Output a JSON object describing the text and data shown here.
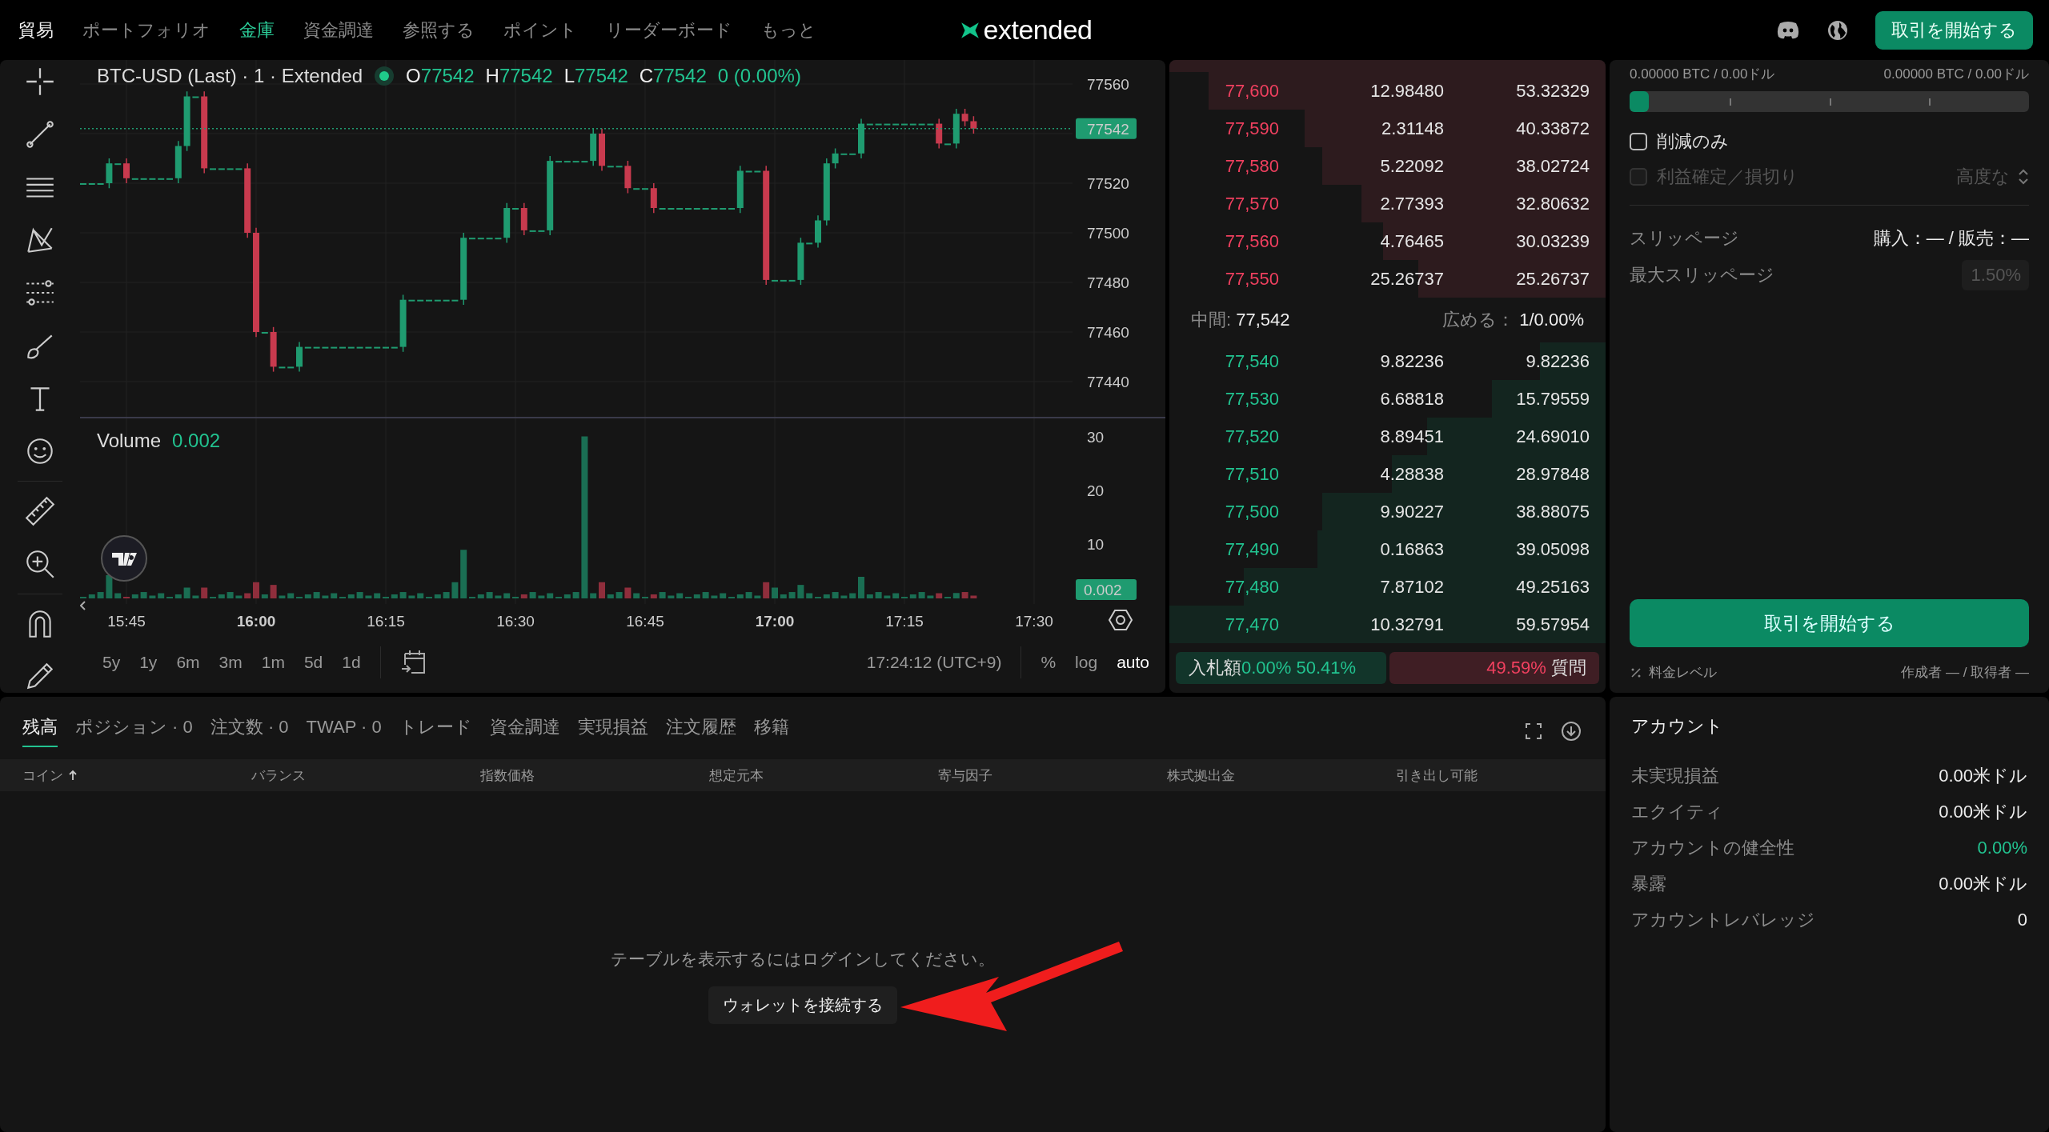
{
  "nav": {
    "items": [
      {
        "label": "貿易",
        "selected": true,
        "hovered": false
      },
      {
        "label": "ポートフォリオ",
        "selected": false,
        "hovered": false
      },
      {
        "label": "金庫",
        "selected": false,
        "hovered": true
      },
      {
        "label": "資金調達",
        "selected": false,
        "hovered": false
      },
      {
        "label": "参照する",
        "selected": false,
        "hovered": false
      },
      {
        "label": "ポイント",
        "selected": false,
        "hovered": false
      },
      {
        "label": "リーダーボード",
        "selected": false,
        "hovered": false
      },
      {
        "label": "もっと",
        "selected": false,
        "hovered": false
      }
    ],
    "logo": "extended",
    "start_button": "取引を開始する"
  },
  "chart": {
    "symbol": "BTC-USD (Last) · 1 · Extended",
    "ohlc": [
      {
        "key": "O",
        "value": "77542"
      },
      {
        "key": "H",
        "value": "77542"
      },
      {
        "key": "L",
        "value": "77542"
      },
      {
        "key": "C",
        "value": "77542"
      }
    ],
    "change": "0 (0.00%)",
    "price_labels": [
      "77560",
      "77520",
      "77500",
      "77480",
      "77460",
      "77440"
    ],
    "last_price": "77542",
    "volume_label": "Volume",
    "volume_value": "0.002",
    "volume_labels": [
      "30",
      "20",
      "10"
    ],
    "volume_badge": "0.002",
    "time_labels": [
      {
        "text": "15:45",
        "emphasized": false
      },
      {
        "text": "16:00",
        "emphasized": true
      },
      {
        "text": "16:15",
        "emphasized": false
      },
      {
        "text": "16:30",
        "emphasized": false
      },
      {
        "text": "16:45",
        "emphasized": false
      },
      {
        "text": "17:00",
        "emphasized": true
      },
      {
        "text": "17:15",
        "emphasized": false
      },
      {
        "text": "17:30",
        "emphasized": false
      }
    ],
    "ranges": [
      "5y",
      "1y",
      "6m",
      "3m",
      "1m",
      "5d",
      "1d"
    ],
    "clock": "17:24:12 (UTC+9)",
    "scale_options": [
      {
        "label": "%",
        "selected": false
      },
      {
        "label": "log",
        "selected": false
      },
      {
        "label": "auto",
        "selected": true
      }
    ]
  },
  "orderbook": {
    "asks": [
      {
        "price": "77,600",
        "size": "12.98480",
        "total": "53.32329",
        "level": 0.91
      },
      {
        "price": "77,590",
        "size": "2.31148",
        "total": "40.33872",
        "level": 0.69
      },
      {
        "price": "77,580",
        "size": "5.22092",
        "total": "38.02724",
        "level": 0.65
      },
      {
        "price": "77,570",
        "size": "2.77393",
        "total": "32.80632",
        "level": 0.56
      },
      {
        "price": "77,560",
        "size": "4.76465",
        "total": "30.03239",
        "level": 0.51
      },
      {
        "price": "77,550",
        "size": "25.26737",
        "total": "25.26737",
        "level": 0.43
      }
    ],
    "mid": {
      "label": "中間:",
      "value": "77,542",
      "spread_label": "広める：",
      "spread_value": "1/0.00%"
    },
    "bids": [
      {
        "price": "77,540",
        "size": "9.82236",
        "total": "9.82236",
        "level": 0.15
      },
      {
        "price": "77,530",
        "size": "6.68818",
        "total": "15.79559",
        "level": 0.26
      },
      {
        "price": "77,520",
        "size": "8.89451",
        "total": "24.69010",
        "level": 0.41
      },
      {
        "price": "77,510",
        "size": "4.28838",
        "total": "28.97848",
        "level": 0.49
      },
      {
        "price": "77,500",
        "size": "9.90227",
        "total": "38.88075",
        "level": 0.65
      },
      {
        "price": "77,490",
        "size": "0.16863",
        "total": "39.05098",
        "level": 0.66
      },
      {
        "price": "77,480",
        "size": "7.87102",
        "total": "49.25163",
        "level": 0.83
      },
      {
        "price": "77,470",
        "size": "10.32791",
        "total": "59.57954",
        "level": 1.0
      }
    ],
    "bid_ratio": {
      "label": "入札額",
      "value": "0.00% 50.41%"
    },
    "ask_ratio": {
      "value": "49.59%",
      "label": "質問"
    }
  },
  "order_form": {
    "balance_left": "0.00000 BTC / 0.00ドル",
    "balance_right": "0.00000 BTC / 0.00ドル",
    "size_slider": {
      "level": 0
    },
    "options": [
      {
        "label": "削減のみ",
        "checked": false,
        "disabled": false
      },
      {
        "label": "利益確定／損切り",
        "checked": false,
        "disabled": true
      }
    ],
    "advanced": "高度な",
    "slippage": {
      "label": "スリッページ",
      "value": "購入：— / 販売：—"
    },
    "max_slippage": {
      "label": "最大スリッページ",
      "placeholder": "1.50%"
    },
    "submit": "取引を開始する",
    "fee_level": "料金レベル",
    "fees": "作成者 — / 取得者 —"
  },
  "positions": {
    "tabs": [
      {
        "label": "残高",
        "selected": true
      },
      {
        "label": "ポジション · 0",
        "selected": false
      },
      {
        "label": "注文数 · 0",
        "selected": false
      },
      {
        "label": "TWAP · 0",
        "selected": false
      },
      {
        "label": "トレード",
        "selected": false
      },
      {
        "label": "資金調達",
        "selected": false
      },
      {
        "label": "実現損益",
        "selected": false
      },
      {
        "label": "注文履歴",
        "selected": false
      },
      {
        "label": "移籍",
        "selected": false
      }
    ],
    "columns": [
      {
        "label": "コイン",
        "sorted": true
      },
      {
        "label": "バランス",
        "sorted": false
      },
      {
        "label": "指数価格",
        "sorted": false
      },
      {
        "label": "想定元本",
        "sorted": false
      },
      {
        "label": "寄与因子",
        "sorted": false
      },
      {
        "label": "株式拠出金",
        "sorted": false
      },
      {
        "label": "引き出し可能",
        "sorted": false
      }
    ],
    "empty_message": "テーブルを表示するにはログインしてください。",
    "connect_button": "ウォレットを接続する"
  },
  "account": {
    "title": "アカウント",
    "rows": [
      {
        "label": "未実現損益",
        "value": "0.00米ドル",
        "kind": "plain"
      },
      {
        "label": "エクイティ",
        "value": "0.00米ドル",
        "kind": "plain"
      },
      {
        "label": "アカウントの健全性",
        "value": "0.00%",
        "kind": "positive"
      },
      {
        "label": "暴露",
        "value": "0.00米ドル",
        "kind": "plain"
      },
      {
        "label": "アカウントレバレッジ",
        "value": "0",
        "kind": "plain"
      }
    ]
  }
}
